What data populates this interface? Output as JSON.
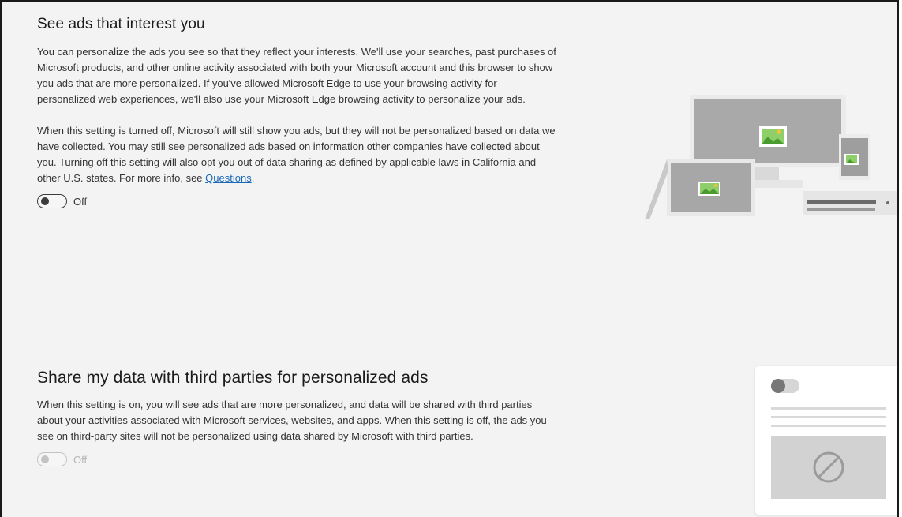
{
  "section_ads": {
    "title": "See ads that interest you",
    "paragraph1": "You can personalize the ads you see so that they reflect your interests. We'll use your searches, past purchases of Microsoft products, and other online activity associated with both your Microsoft account and this browser to show you ads that are more personalized. If you've allowed Microsoft Edge to use your browsing activity for personalized web experiences, we'll also use your Microsoft Edge browsing activity to personalize your ads.",
    "paragraph2": "When this setting is turned off, Microsoft will still show you ads, but they will not be personalized based on data we have collected. You may still see personalized ads based on information other companies have collected about you. Turning off this setting will also opt you out of data sharing as defined by applicable laws in California and other U.S. states. For more info, see",
    "link_text": "Questions",
    "link_suffix": ".",
    "toggle_state": "Off",
    "toggle_on": false
  },
  "section_share": {
    "title": "Share my data with third parties for personalized ads",
    "paragraph": "When this setting is on, you will see ads that are more personalized, and data will be shared with third parties about your activities associated with Microsoft services, websites, and apps. When this setting is off, the ads you see on third-party sites will not be personalized using data shared by Microsoft with third parties.",
    "toggle_state": "Off",
    "toggle_on": false,
    "toggle_disabled": true
  },
  "colors": {
    "link": "#1a68b8",
    "background": "#f3f3f3",
    "toggle": "#3b3b3b",
    "toggle_disabled": "#c3c3c3"
  },
  "icons": [
    "devices-illustration",
    "blocked-ads-card-illustration",
    "prohibited-icon"
  ]
}
